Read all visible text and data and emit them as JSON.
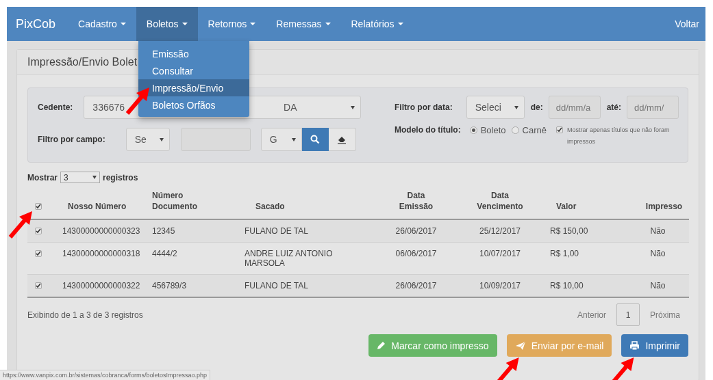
{
  "navbar": {
    "brand": "PixCob",
    "menus": [
      {
        "label": "Cadastro",
        "selected": false
      },
      {
        "label": "Boletos",
        "selected": true
      },
      {
        "label": "Retornos",
        "selected": false
      },
      {
        "label": "Remessas",
        "selected": false
      },
      {
        "label": "Relatórios",
        "selected": false
      }
    ],
    "right_link": "Voltar"
  },
  "dropdown": {
    "items": [
      {
        "label": "Emissão",
        "selected": false,
        "pointed": false
      },
      {
        "label": "Consultar",
        "selected": false,
        "pointed": false
      },
      {
        "label": "Impressão/Envio",
        "selected": true,
        "pointed": true
      },
      {
        "label": "Boletos Orfãos",
        "selected": false,
        "pointed": false
      }
    ]
  },
  "panel": {
    "title": "Impressão/Envio Bolet"
  },
  "filters": {
    "cedente_label": "Cedente:",
    "cedente_value_start": "336676",
    "cedente_value_end": "DA",
    "campo_label": "Filtro por campo:",
    "campo_select": "Se",
    "campo_type_select": "G",
    "data_label": "Filtro por data:",
    "data_select": "Seleci",
    "de_label": "de:",
    "de_placeholder": "dd/mm/a",
    "ate_label": "até:",
    "ate_placeholder": "dd/mm/",
    "modelo_label": "Modelo do título:",
    "modelo_options": [
      {
        "label": "Boleto",
        "selected": true
      },
      {
        "label": "Carnê",
        "selected": false
      }
    ],
    "only_unprinted": {
      "label": "Mostrar apenas títulos que não foram impressos",
      "checked": true
    }
  },
  "length": {
    "before": "Mostrar",
    "value": "3",
    "after": "registros"
  },
  "table": {
    "all_checked": true,
    "all_pointed": true,
    "columns": [
      "Nosso Número",
      "Número Documento",
      "Sacado",
      "Data Emissão",
      "Data Vencimento",
      "Valor",
      "Impresso"
    ],
    "rows": [
      {
        "checked": true,
        "cells": [
          "14300000000000323",
          "12345",
          "FULANO DE TAL",
          "26/06/2017",
          "25/12/2017",
          "R$ 150,00",
          "Não"
        ]
      },
      {
        "checked": true,
        "cells": [
          "14300000000000318",
          "4444/2",
          "ANDRE LUIZ ANTONIO MARSOLA",
          "06/06/2017",
          "10/07/2017",
          "R$ 1,00",
          "Não"
        ]
      },
      {
        "checked": true,
        "cells": [
          "14300000000000322",
          "456789/3",
          "FULANO DE TAL",
          "26/06/2017",
          "10/09/2017",
          "R$ 10,00",
          "Não"
        ]
      }
    ]
  },
  "info": "Exibindo de 1 a 3 de 3 registros",
  "pagination": {
    "previous": "Anterior",
    "pages": [
      {
        "label": "1",
        "selected": true
      }
    ],
    "next": "Próxima"
  },
  "actions": [
    {
      "kind": "mark",
      "label": "Marcar como impresso",
      "pointed": false
    },
    {
      "kind": "email",
      "label": "Enviar por e-mail",
      "pointed": true
    },
    {
      "kind": "print",
      "label": "Imprimir",
      "pointed": true
    }
  ],
  "status_url": "https://www.vanpix.com.br/sistemas/cobranca/forms/boletosImpressao.php"
}
